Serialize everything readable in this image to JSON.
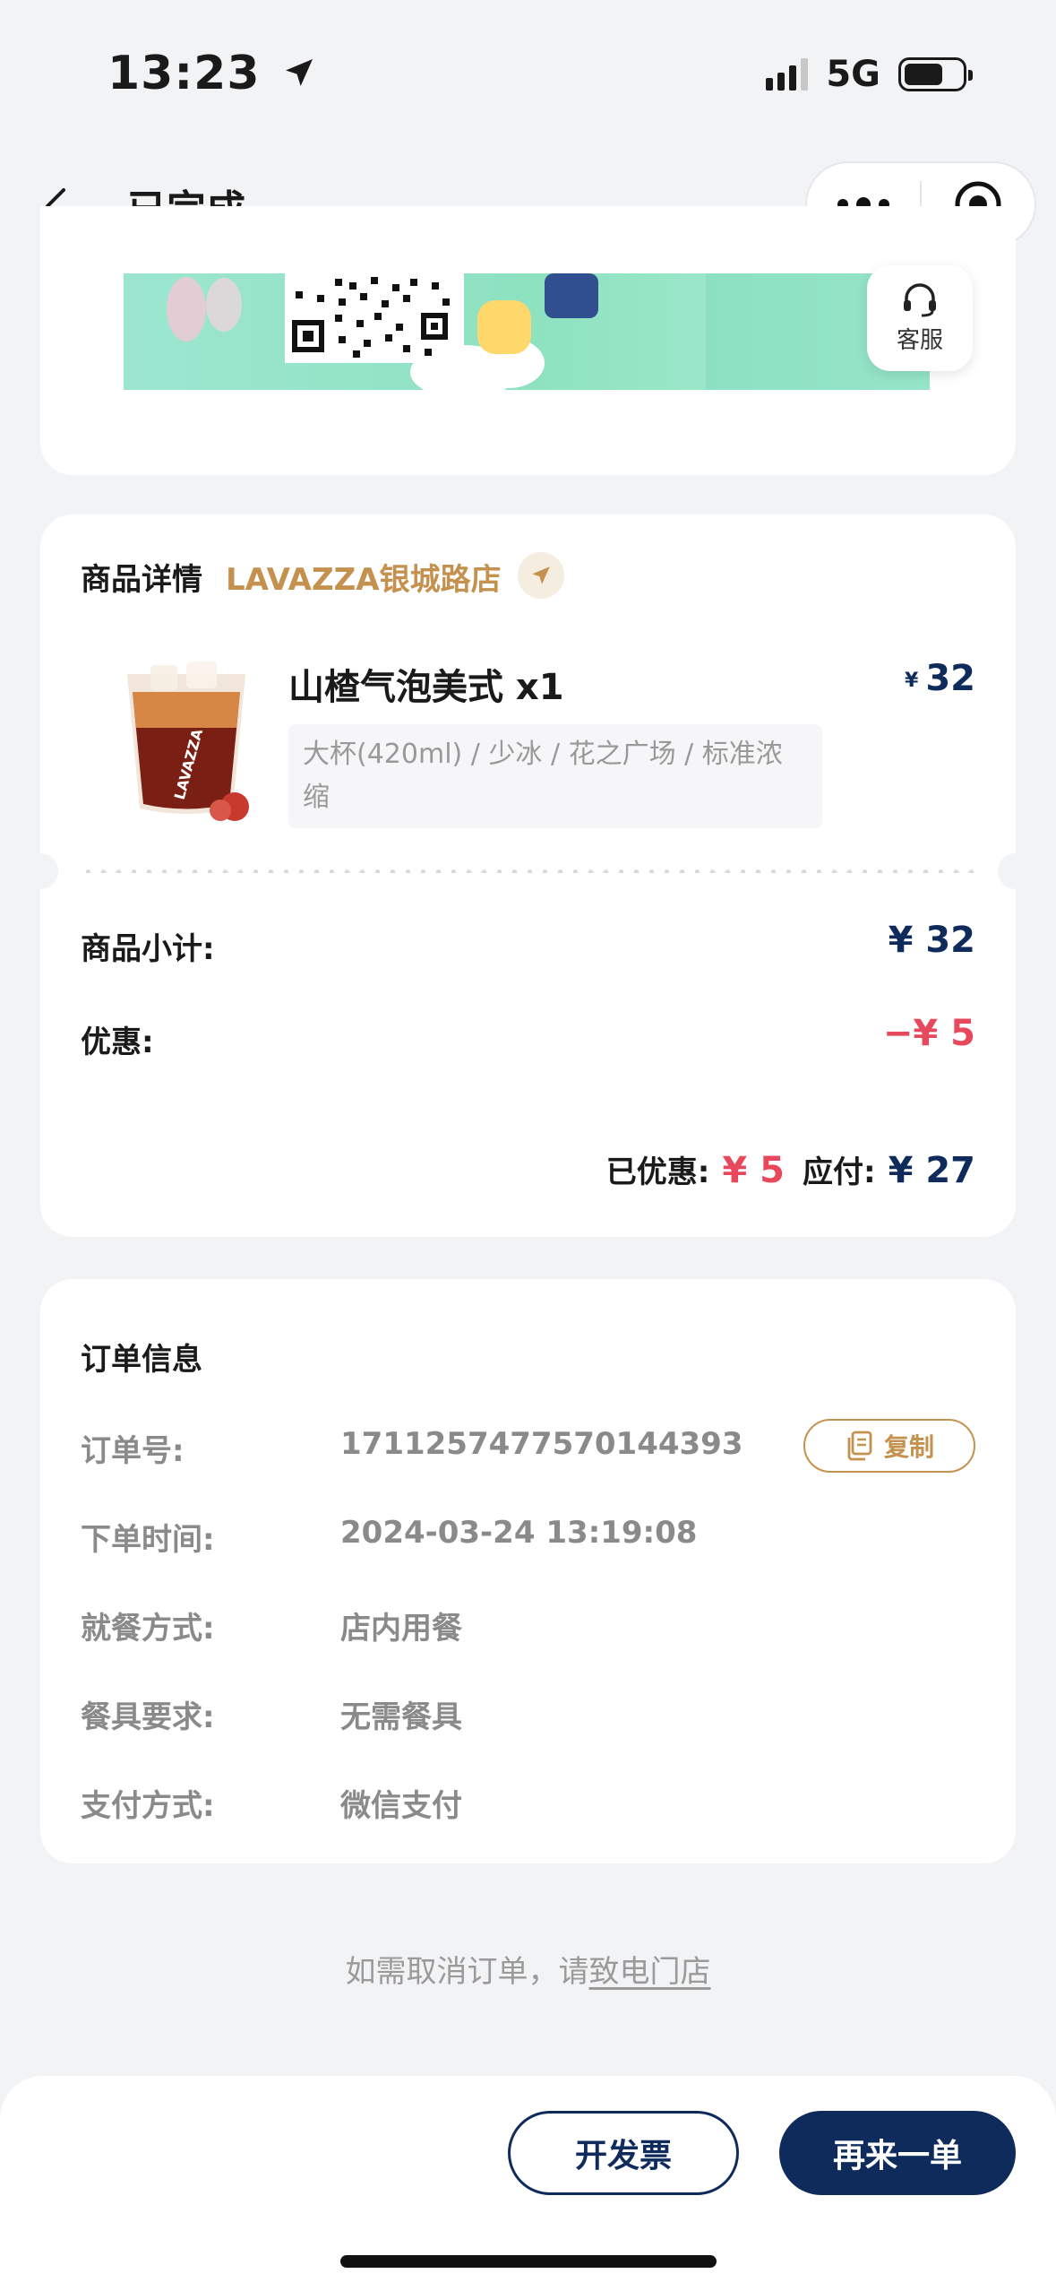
{
  "status_bar": {
    "time": "13:23",
    "network": "5G",
    "battery_level": 0.68
  },
  "nav": {
    "title": "已完成"
  },
  "service": {
    "label": "客服"
  },
  "product_card": {
    "section_title": "商品详情",
    "store_name": "LAVAZZA银城路店",
    "product": {
      "name": "山楂气泡美式 x1",
      "currency": "¥",
      "price": "32",
      "spec": "大杯(420ml) / 少冰 / 花之广场 / 标准浓缩",
      "cup_brand": "LAVAZZA"
    },
    "subtotal_label": "商品小计:",
    "subtotal_value": "¥ 32",
    "discount_label": "优惠:",
    "discount_value": "−¥ 5",
    "saved_label": "已优惠:",
    "saved_value": "¥ 5",
    "payable_label": "应付:",
    "payable_value": "¥ 27"
  },
  "order_info": {
    "title": "订单信息",
    "rows": [
      {
        "label": "订单号:",
        "value": "1711257477570144393"
      },
      {
        "label": "下单时间:",
        "value": "2024-03-24 13:19:08"
      },
      {
        "label": "就餐方式:",
        "value": "店内用餐"
      },
      {
        "label": "餐具要求:",
        "value": "无需餐具"
      },
      {
        "label": "支付方式:",
        "value": "微信支付"
      }
    ],
    "copy_label": "复制"
  },
  "cancel_tip": {
    "text": "如需取消订单，请",
    "link": "致电门店"
  },
  "actions": {
    "invoice": "开发票",
    "reorder": "再来一单"
  },
  "colors": {
    "navy": "#0e2b5c",
    "gold": "#c4914f",
    "red": "#e8485c"
  }
}
